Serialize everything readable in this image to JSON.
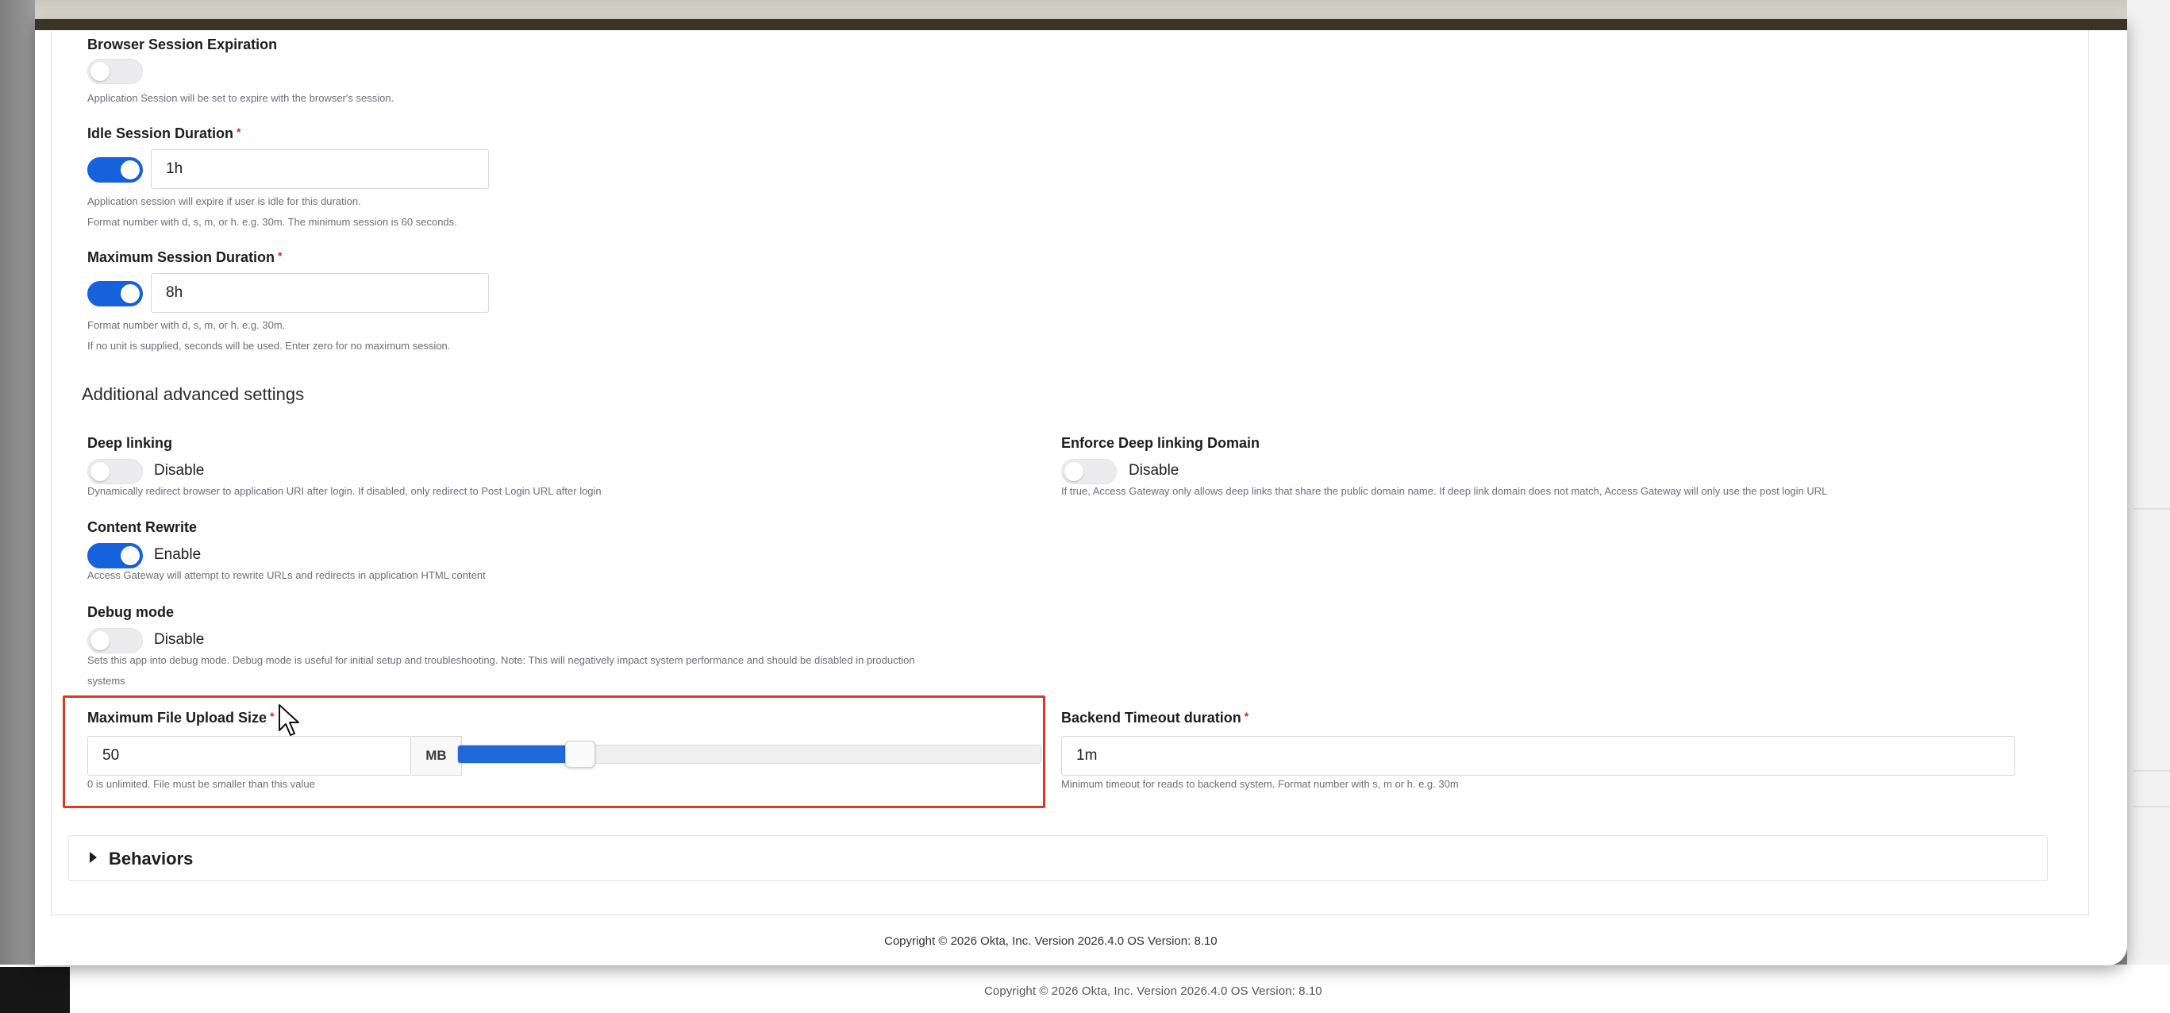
{
  "session": {
    "browser_expiration": {
      "label": "Browser Session Expiration",
      "enabled": false,
      "hint": "Application Session will be set to expire with the browser's session."
    },
    "idle_duration": {
      "label": "Idle Session Duration",
      "required_mark": "*",
      "enabled": true,
      "value": "1h",
      "hint1": "Application session will expire if user is idle for this duration.",
      "hint2": "Format number with d, s, m, or h. e.g. 30m. The minimum session is 60 seconds."
    },
    "max_duration": {
      "label": "Maximum Session Duration",
      "required_mark": "*",
      "enabled": true,
      "value": "8h",
      "hint1": "Format number with d, s, m, or h. e.g. 30m.",
      "hint2": "If no unit is supplied, seconds will be used. Enter zero for no maximum session."
    }
  },
  "advanced": {
    "title": "Additional advanced settings",
    "deep_linking": {
      "label": "Deep linking",
      "state_label": "Disable",
      "enabled": false,
      "hint": "Dynamically redirect browser to application URI after login. If disabled, only redirect to Post Login URL after login"
    },
    "enforce_deep_linking_domain": {
      "label": "Enforce Deep linking Domain",
      "state_label": "Disable",
      "enabled": false,
      "hint": "If true, Access Gateway only allows deep links that share the public domain name. If deep link domain does not match, Access Gateway will only use the post login URL"
    },
    "content_rewrite": {
      "label": "Content Rewrite",
      "state_label": "Enable",
      "enabled": true,
      "hint": "Access Gateway will attempt to rewrite URLs and redirects in application HTML content"
    },
    "debug_mode": {
      "label": "Debug mode",
      "state_label": "Disable",
      "enabled": false,
      "hint1": "Sets this app into debug mode. Debug mode is useful for initial setup and troubleshooting. Note: This will negatively impact system performance and should be disabled in production",
      "hint2": "systems"
    },
    "max_file_upload": {
      "label": "Maximum File Upload Size",
      "required_mark": "*",
      "value": "50",
      "unit": "MB",
      "slider_fraction": 0.2,
      "hint": "0 is unlimited. File must be smaller than this value"
    },
    "backend_timeout": {
      "label": "Backend Timeout duration",
      "required_mark": "*",
      "value": "1m",
      "hint": "Minimum timeout for reads to backend system. Format number with s, m or h. e.g. 30m"
    }
  },
  "behaviors": {
    "label": "Behaviors"
  },
  "footer": {
    "copyright": "Copyright © 2026 Okta, Inc. Version 2026.4.0 OS Version: 8.10"
  },
  "colors": {
    "accent": "#1662dd",
    "highlight_border": "#d93a26",
    "required": "#d6261a"
  }
}
